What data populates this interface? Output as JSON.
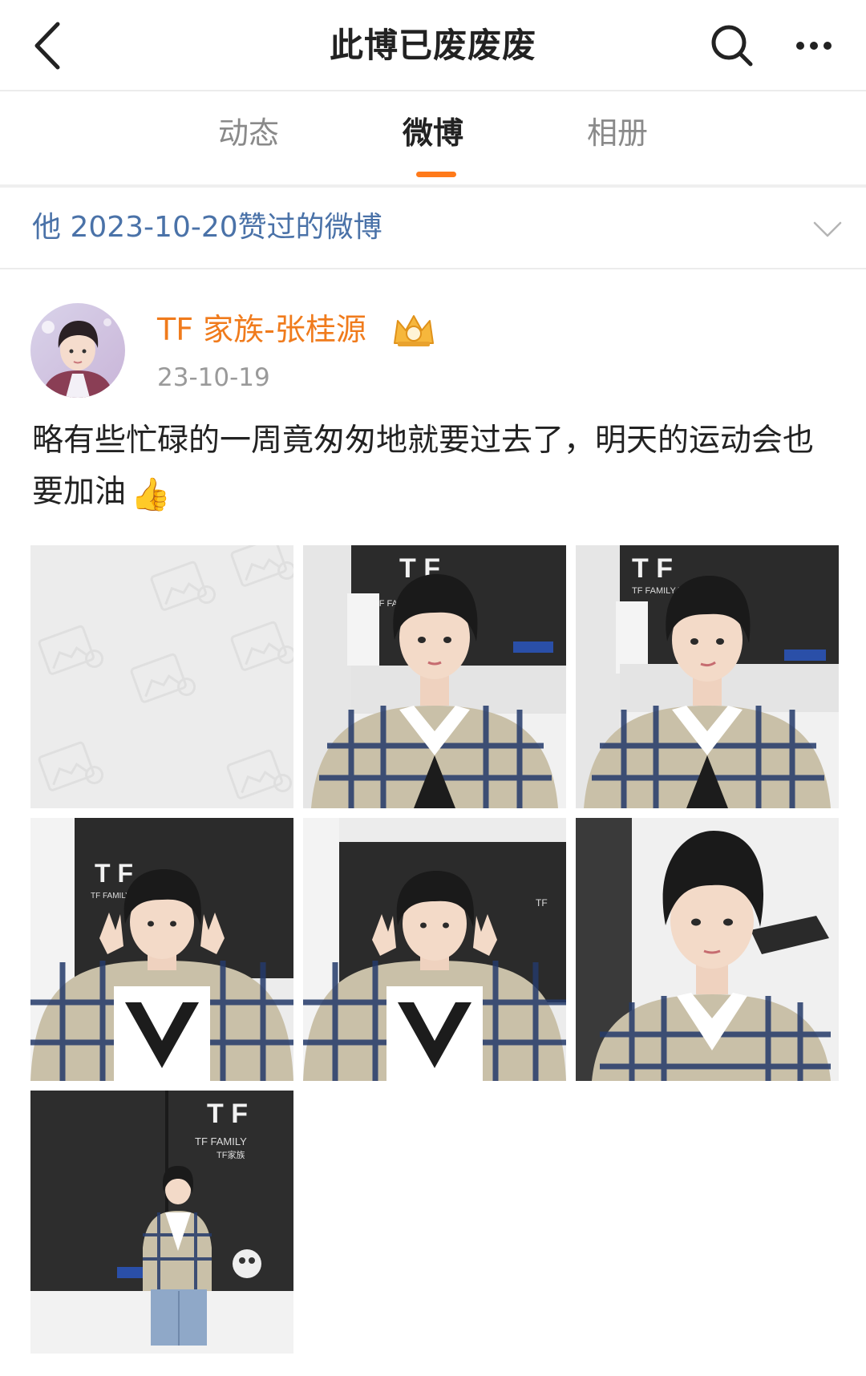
{
  "header": {
    "title": "此博已废废废",
    "back_icon": "chevron-left-icon",
    "search_icon": "search-icon",
    "more_icon": "more-dots-icon"
  },
  "tabs": [
    {
      "label": "动态",
      "active": false
    },
    {
      "label": "微博",
      "active": true
    },
    {
      "label": "相册",
      "active": false
    }
  ],
  "colors": {
    "accent": "#ff7a1a",
    "author_name": "#f07b1c",
    "liked_link": "#4a72a8"
  },
  "liked_section": {
    "text": "他 2023-10-20赞过的微博",
    "expand_icon": "chevron-down-icon"
  },
  "post": {
    "author": "TF 家族-张桂源",
    "badge_icon": "crown-badge-icon",
    "date": "23-10-19",
    "text": "略有些忙碌的一周竟匆匆地就要过去了，明天的运动会也要加油",
    "emoji": "👍",
    "photos": [
      {
        "kind": "placeholder"
      },
      {
        "kind": "photo",
        "backdrop_text": "TF FAMILY TF家族"
      },
      {
        "kind": "photo",
        "backdrop_text": "TF FAMILY TF家族"
      },
      {
        "kind": "photo",
        "backdrop_text": "TF FAMILY TF家族"
      },
      {
        "kind": "photo",
        "backdrop_text": "TF FAMILY"
      },
      {
        "kind": "photo"
      },
      {
        "kind": "photo",
        "backdrop_text": "TF FAMILY TF家族"
      }
    ]
  }
}
